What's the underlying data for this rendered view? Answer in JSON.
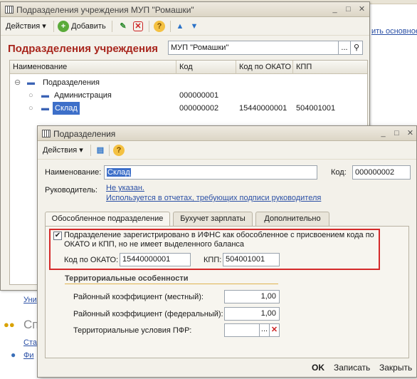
{
  "win1": {
    "title": "Подразделения учреждения МУП \"Ромашки\"",
    "toolbar": {
      "actions": "Действия",
      "add": "Добавить"
    },
    "heading": "Подразделения учреждения",
    "org_field": "МУП \"Ромашки\"",
    "columns": [
      "Наименование",
      "Код",
      "Код по ОКАТО",
      "КПП"
    ],
    "rows": [
      {
        "name": "Подразделения",
        "code": "",
        "okato": "",
        "kpp": ""
      },
      {
        "name": "Администрация",
        "code": "000000001",
        "okato": "",
        "kpp": ""
      },
      {
        "name": "Склад",
        "code": "000000002",
        "okato": "15440000001",
        "kpp": "504001001"
      }
    ]
  },
  "background": {
    "link_right": "ить основное",
    "link_bl": "Уни",
    "text_bl2": "Сп",
    "link_bl3": "Ста",
    "link_bl4": "Фи"
  },
  "win2": {
    "title": "Подразделения",
    "toolbar": {
      "actions": "Действия"
    },
    "name_label": "Наименование:",
    "name_value": "Склад",
    "code_label": "Код:",
    "code_value": "000000002",
    "manager_label": "Руководитель:",
    "manager_value": "Не указан.",
    "manager_hint": "Используется в отчетах, требующих подписи руководителя",
    "tabs": [
      "Обособленное подразделение",
      "Бухучет зарплаты",
      "Дополнительно"
    ],
    "checkbox_text_1": "Подразделение зарегистрировано в ИФНС как обособленное с присвоением кода по",
    "checkbox_text_2": "ОКАТО и КПП, но не имеет выделенного баланса",
    "okato_label": "Код по ОКАТО:",
    "okato_value": "15440000001",
    "kpp_label": "КПП:",
    "kpp_value": "504001001",
    "territorial_heading": "Территориальные особенности",
    "regional_local_label": "Районный коэффициент (местный):",
    "regional_local_value": "1,00",
    "regional_federal_label": "Районный коэффициент (федеральный):",
    "regional_federal_value": "1,00",
    "pfr_label": "Территориальные условия ПФР:",
    "pfr_value": "",
    "footer": {
      "ok": "OK",
      "save": "Записать",
      "close": "Закрыть"
    }
  }
}
